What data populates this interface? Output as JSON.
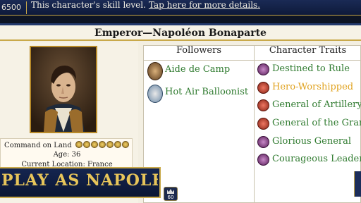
{
  "topbar": {
    "treasury": "6500",
    "tip": "This character's skill level.",
    "tip_link": "Tap here for more details."
  },
  "character": {
    "title": "Emperor—Napoléon Bonaparte",
    "command_label": "Command on Land",
    "command_stars": 7,
    "age": "Age: 36",
    "location": "Current Location: France"
  },
  "followers": {
    "header": "Followers",
    "items": [
      {
        "label": "Aide de Camp",
        "icon": "aide-de-camp-icon"
      },
      {
        "label": "Hot Air Balloonist",
        "icon": "hot-air-balloon-icon"
      }
    ]
  },
  "traits": {
    "header": "Character Traits",
    "items": [
      {
        "label": "Destined to Rule",
        "color": "#2e7a2e",
        "icon": "purple"
      },
      {
        "label": "Hero-Worshipped",
        "color": "#e0a21e",
        "icon": "red"
      },
      {
        "label": "General of Artillery",
        "color": "#2e7a2e",
        "icon": "red"
      },
      {
        "label": "General of the Grand Army",
        "color": "#2e7a2e",
        "icon": "red"
      },
      {
        "label": "Glorious General",
        "color": "#2e7a2e",
        "icon": "purple"
      },
      {
        "label": "Courageous Leader",
        "color": "#2e7a2e",
        "icon": "purple"
      }
    ]
  },
  "banner": {
    "text": "PLAY AS NAPOLEON..."
  },
  "bottom_badge": {
    "value": "60"
  }
}
